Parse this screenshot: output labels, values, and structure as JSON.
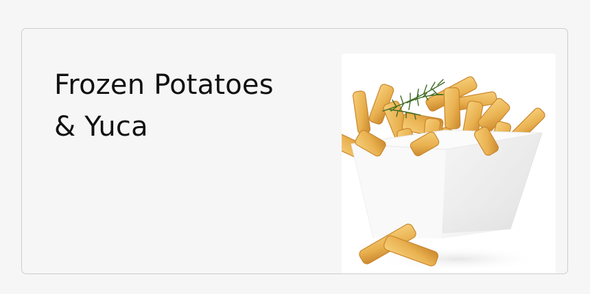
{
  "category_card": {
    "title_line_1": "Frozen Potatoes",
    "title_line_2": "& Yuca",
    "image": {
      "subject": "bowl-of-french-fries",
      "colors": {
        "fry": "#e9b150",
        "fry_edge": "#c9862c",
        "bowl": "#ffffff",
        "herb": "#3d6b22"
      }
    }
  }
}
